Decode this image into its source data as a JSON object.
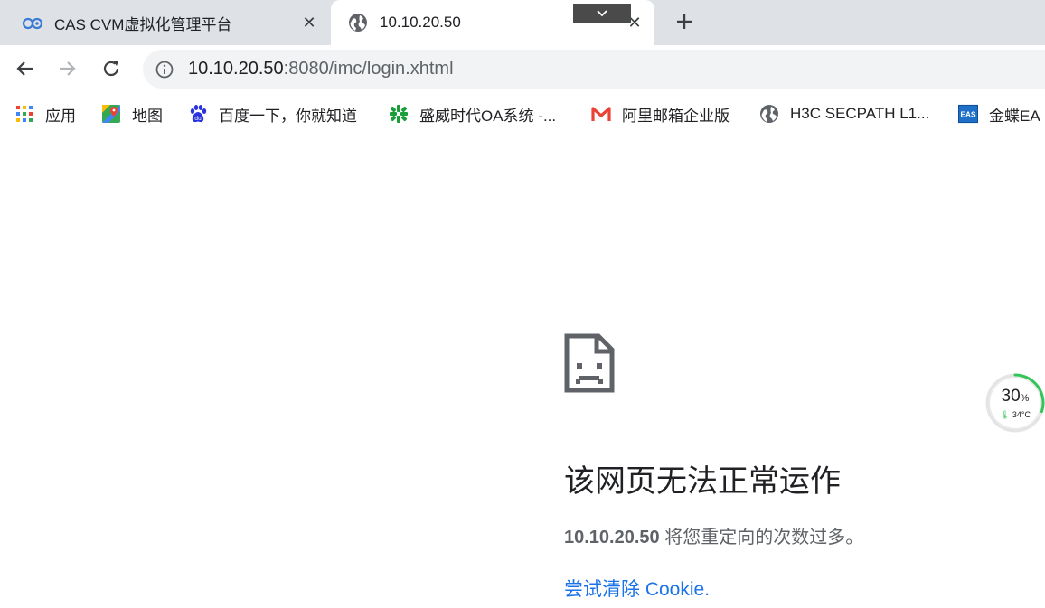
{
  "tabs": [
    {
      "title": "CAS CVM虚拟化管理平台",
      "icon": "cas-logo-icon",
      "active": false
    },
    {
      "title": "10.10.20.50",
      "icon": "globe-icon",
      "active": true
    }
  ],
  "toolbar": {
    "url_host": "10.10.20.50",
    "url_rest": ":8080/imc/login.xhtml"
  },
  "bookmarks": [
    {
      "label": "应用",
      "icon": "apps-grid-icon"
    },
    {
      "label": "地图",
      "icon": "maps-icon"
    },
    {
      "label": "百度一下，你就知道",
      "icon": "baidu-paw-icon"
    },
    {
      "label": "盛威时代OA系统 -...",
      "icon": "shengwei-logo-icon"
    },
    {
      "label": "阿里邮箱企业版",
      "icon": "gmail-m-icon"
    },
    {
      "label": "H3C SECPATH L1...",
      "icon": "globe-icon"
    },
    {
      "label": "金蝶EA",
      "icon": "eas-logo-icon",
      "icon_text": "EAS"
    }
  ],
  "error": {
    "title": "该网页无法正常运作",
    "host": "10.10.20.50",
    "message": " 将您重定向的次数过多。",
    "link": "尝试清除 Cookie."
  },
  "widget": {
    "percent": "30",
    "percent_unit": "%",
    "temperature": "34°C",
    "accent": "#34c759"
  },
  "colors": {
    "tabstrip": "#dee1e6",
    "omnibox": "#f1f3f4",
    "link": "#1a73e8"
  }
}
